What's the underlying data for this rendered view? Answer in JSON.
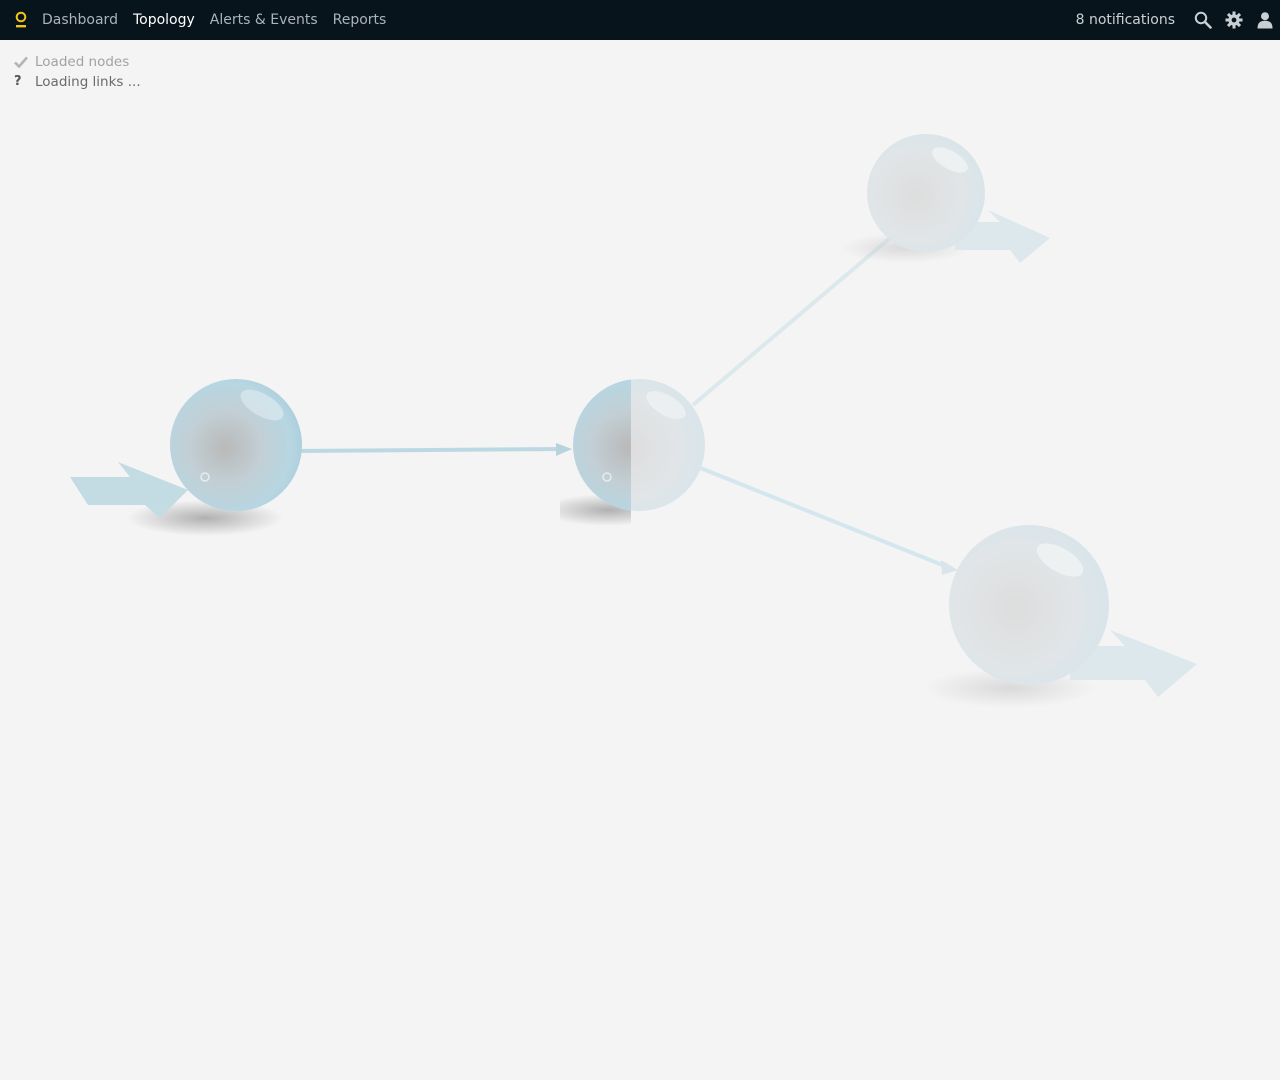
{
  "nav": {
    "items": [
      {
        "label": "Dashboard"
      },
      {
        "label": "Topology",
        "active": true
      },
      {
        "label": "Alerts & Events"
      },
      {
        "label": "Reports"
      }
    ],
    "notifications_label": "8 notifications"
  },
  "status": {
    "nodes_label": "Loaded nodes",
    "links_label": "Loading links ..."
  },
  "colors": {
    "topbar_bg": "#08141c",
    "brand_accent": "#f0c419",
    "canvas_bg": "#f4f4f4",
    "node_tint": "#bcd9e4",
    "link_color": "#bfdbe3"
  },
  "icons": [
    "logo-icon",
    "search-icon",
    "gear-icon",
    "user-icon",
    "check-icon",
    "question-icon"
  ]
}
